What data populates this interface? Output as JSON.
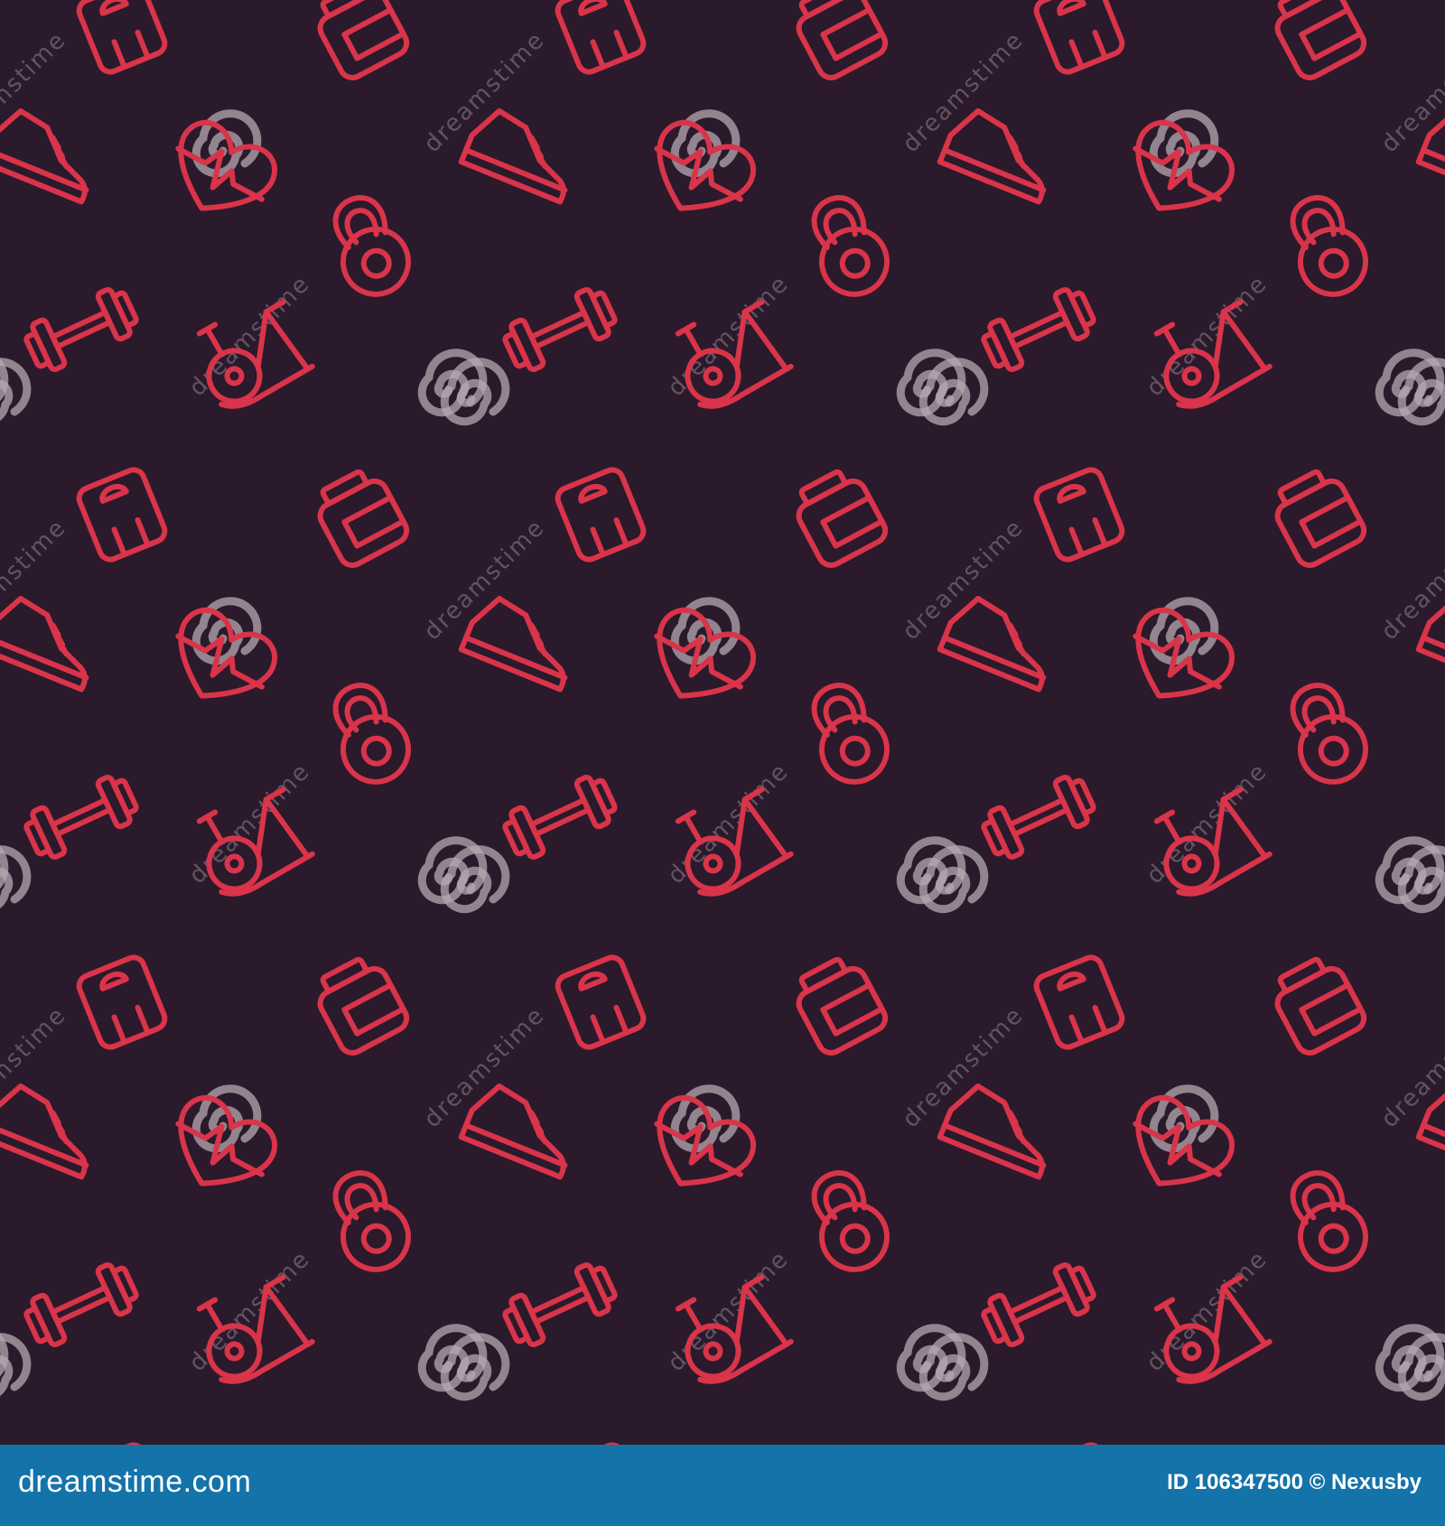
{
  "colors": {
    "background": "#2a1a2b",
    "icon_stroke": "#d9344a",
    "watermark": "#b6a9b3",
    "footer": "#1473a9"
  },
  "pattern": {
    "icons": [
      "scale-icon",
      "jar-icon",
      "sneaker-icon",
      "heart-icon",
      "kettlebell-icon",
      "dumbbell-icon",
      "exercise-bike-icon"
    ],
    "watermark_icon": "spiral-logo-icon",
    "watermark_text": "dreamstime"
  },
  "footer": {
    "site": "dreamstime.com",
    "id_text": "ID 106347500 © Nexusby"
  }
}
